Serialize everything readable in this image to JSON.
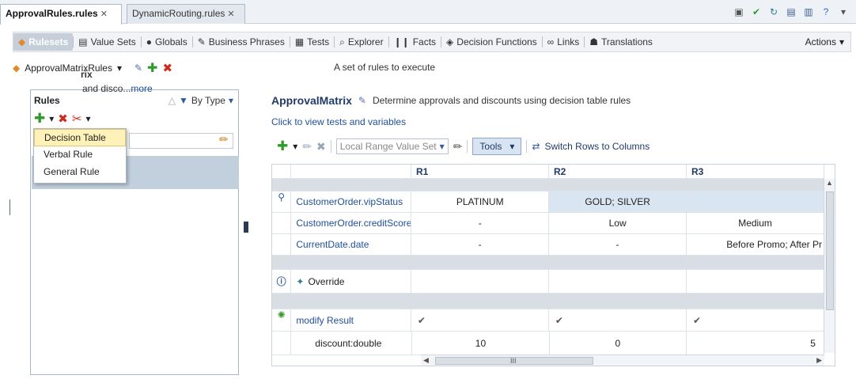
{
  "tabs": [
    {
      "label": "ApprovalRules.rules"
    },
    {
      "label": "DynamicRouting.rules"
    }
  ],
  "nav": {
    "items": [
      "Rulesets",
      "Value Sets",
      "Globals",
      "Business Phrases",
      "Tests",
      "Explorer",
      "Facts",
      "Decision Functions",
      "Links",
      "Translations"
    ],
    "actions": "Actions"
  },
  "ruleset": {
    "name": "ApprovalMatrixRules",
    "description": "A set of rules to execute"
  },
  "rules_panel": {
    "title": "Rules",
    "sort": "By Type",
    "menu": [
      "Decision Table",
      "Verbal Rule",
      "General Rule"
    ],
    "rule_name_fragment": "rix",
    "rule_desc_fragment": "and disco...",
    "more": "more"
  },
  "decision_table": {
    "name": "ApprovalMatrix",
    "description": "Determine approvals and discounts using decision table rules",
    "link": "Click to view tests and variables",
    "value_set": "Local Range Value Set",
    "tools": "Tools",
    "switch": "Switch Rows to Columns",
    "columns": [
      "R1",
      "R2",
      "R3"
    ],
    "conditions": [
      {
        "label": "CustomerOrder.vipStatus",
        "values": [
          "PLATINUM",
          "GOLD; SILVER",
          ""
        ]
      },
      {
        "label": "CustomerOrder.creditScore",
        "values": [
          "-",
          "Low",
          "Medium"
        ]
      },
      {
        "label": "CurrentDate.date",
        "values": [
          "-",
          "-",
          "Before Promo; After Pr"
        ]
      }
    ],
    "override_label": "Override",
    "action": {
      "label": "modify Result",
      "checks": [
        "✔",
        "✔",
        "✔"
      ]
    },
    "param": {
      "label": "discount:double",
      "values": [
        "10",
        "0",
        "5"
      ]
    },
    "scroll_mark": "III"
  }
}
